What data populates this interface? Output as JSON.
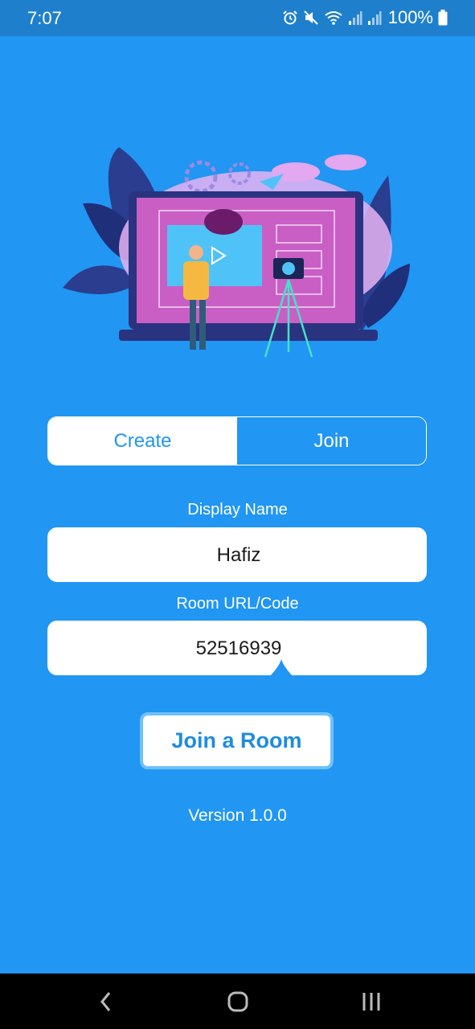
{
  "status_bar": {
    "time": "7:07",
    "battery": "100%",
    "icons": [
      "alarm-icon",
      "mute-icon",
      "wifi-icon",
      "signal-icon",
      "signal-icon",
      "battery-icon"
    ]
  },
  "illustration": {
    "name": "video-conference-illustration"
  },
  "tabs": {
    "create": "Create",
    "join": "Join",
    "selected": "Join"
  },
  "form": {
    "display_name_label": "Display Name",
    "display_name_value": "Hafiz",
    "room_label": "Room URL/Code",
    "room_value": "52516939"
  },
  "join_button": "Join a Room",
  "version": "Version 1.0.0",
  "nav": {
    "icons": [
      "back-icon",
      "home-icon",
      "recents-icon"
    ]
  },
  "colors": {
    "background": "#2196F3",
    "status_bar": "#1E80CD",
    "accent": "#1F8CE0"
  }
}
